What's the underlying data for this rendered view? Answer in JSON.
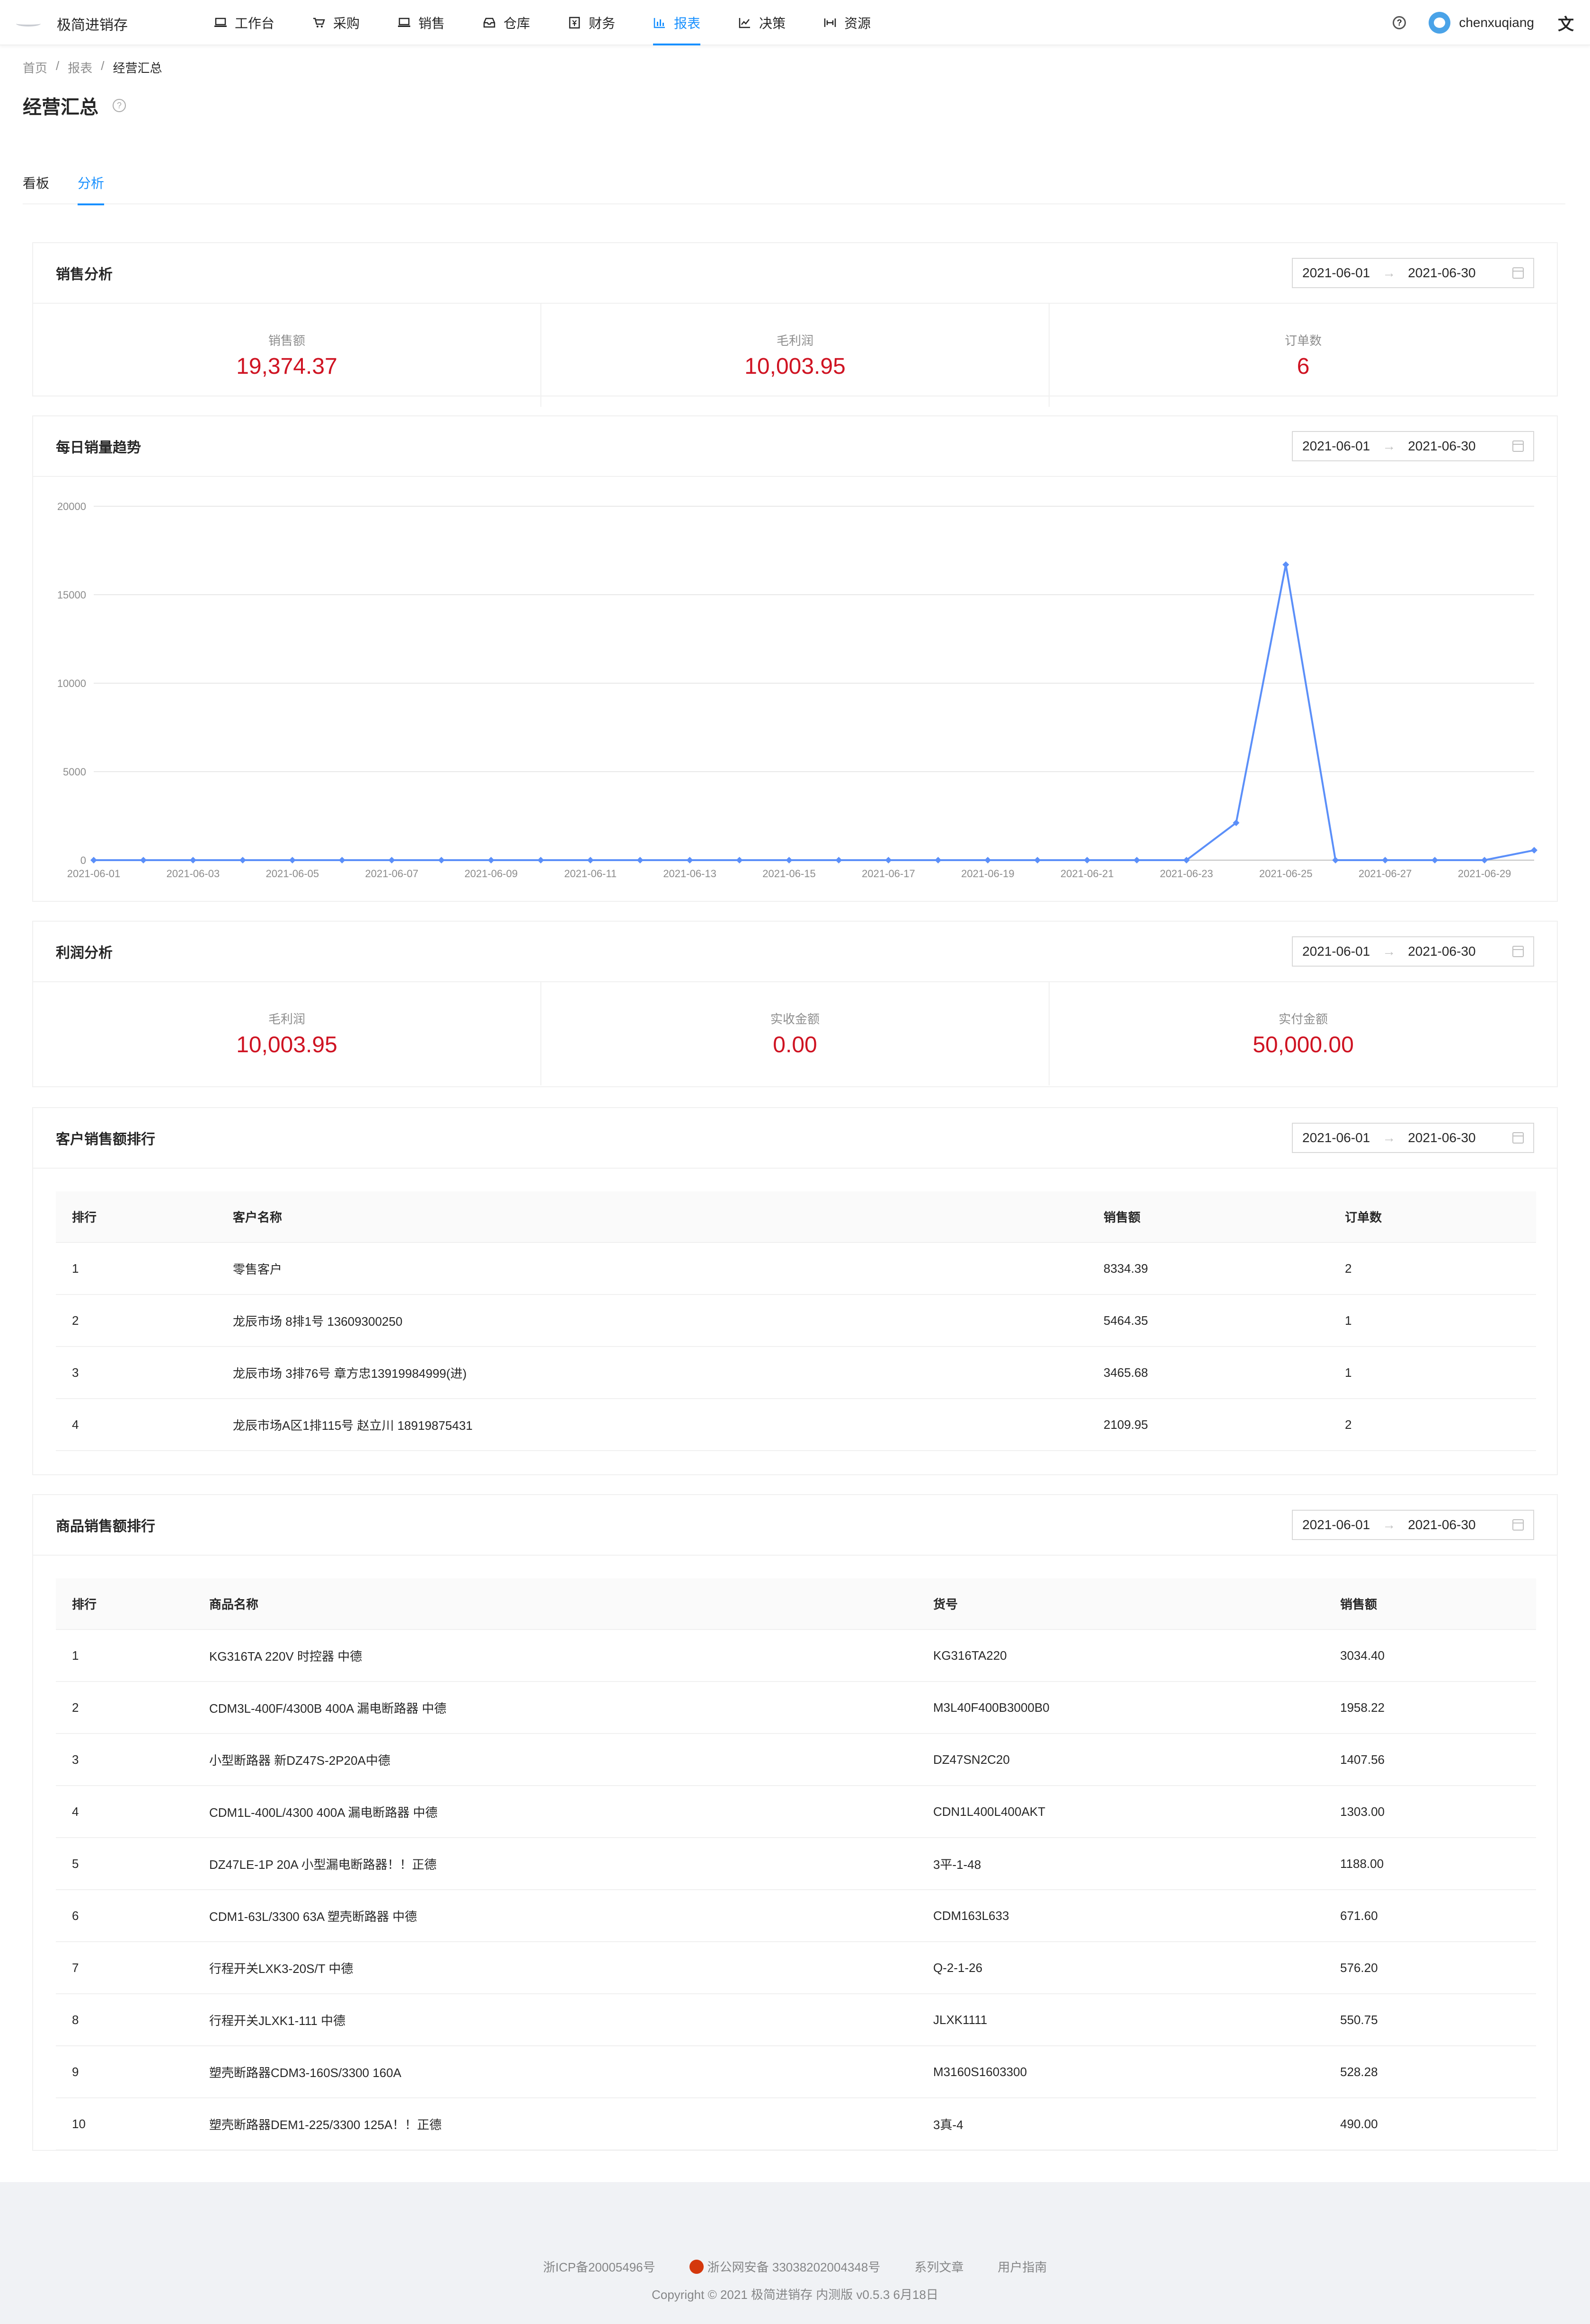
{
  "app": {
    "name": "极简进销存"
  },
  "nav": [
    {
      "label": "工作台",
      "icon": "laptop-icon"
    },
    {
      "label": "采购",
      "icon": "cart-icon"
    },
    {
      "label": "销售",
      "icon": "laptop-icon"
    },
    {
      "label": "仓库",
      "icon": "inbox-icon"
    },
    {
      "label": "财务",
      "icon": "money-icon"
    },
    {
      "label": "报表",
      "icon": "bar-chart-icon"
    },
    {
      "label": "决策",
      "icon": "line-chart-icon"
    },
    {
      "label": "资源",
      "icon": "gateway-icon"
    }
  ],
  "user": {
    "name": "chenxuqiang"
  },
  "breadcrumb": [
    "首页",
    "报表",
    "经营汇总"
  ],
  "page_title": "经营汇总",
  "tabs": [
    "看板",
    "分析"
  ],
  "date_range": {
    "start": "2021-06-01",
    "end": "2021-06-30",
    "arrow": "→"
  },
  "sales_analysis": {
    "title": "销售分析",
    "stats": [
      {
        "label": "销售额",
        "value": "19,374.37"
      },
      {
        "label": "毛利润",
        "value": "10,003.95"
      },
      {
        "label": "订单数",
        "value": "6"
      }
    ]
  },
  "trend": {
    "title": "每日销量趋势"
  },
  "chart_data": {
    "type": "line",
    "x": [
      "2021-06-01",
      "2021-06-02",
      "2021-06-03",
      "2021-06-04",
      "2021-06-05",
      "2021-06-06",
      "2021-06-07",
      "2021-06-08",
      "2021-06-09",
      "2021-06-10",
      "2021-06-11",
      "2021-06-12",
      "2021-06-13",
      "2021-06-14",
      "2021-06-15",
      "2021-06-16",
      "2021-06-17",
      "2021-06-18",
      "2021-06-19",
      "2021-06-20",
      "2021-06-21",
      "2021-06-22",
      "2021-06-23",
      "2021-06-24",
      "2021-06-25",
      "2021-06-26",
      "2021-06-27",
      "2021-06-28",
      "2021-06-29",
      "2021-06-30"
    ],
    "x_tick_labels": [
      "2021-06-01",
      "2021-06-03",
      "2021-06-05",
      "2021-06-07",
      "2021-06-09",
      "2021-06-11",
      "2021-06-13",
      "2021-06-15",
      "2021-06-17",
      "2021-06-19",
      "2021-06-21",
      "2021-06-23",
      "2021-06-25",
      "2021-06-27",
      "2021-06-29"
    ],
    "y": [
      0,
      0,
      0,
      0,
      0,
      0,
      0,
      0,
      0,
      0,
      0,
      0,
      0,
      0,
      0,
      0,
      0,
      0,
      0,
      0,
      0,
      0,
      0,
      2110,
      16700,
      0,
      0,
      0,
      0,
      560
    ],
    "y_ticks": [
      "0",
      "5000",
      "10000",
      "15000",
      "20000"
    ],
    "ylim": [
      0,
      20000
    ],
    "grid": true,
    "color": "#5b8ff9"
  },
  "profit_analysis": {
    "title": "利润分析",
    "stats": [
      {
        "label": "毛利润",
        "value": "10,003.95"
      },
      {
        "label": "实收金额",
        "value": "0.00"
      },
      {
        "label": "实付金额",
        "value": "50,000.00"
      }
    ]
  },
  "customer_rank": {
    "title": "客户销售额排行",
    "columns": [
      "排行",
      "客户名称",
      "销售额",
      "订单数"
    ],
    "rows": [
      [
        "1",
        "零售客户",
        "8334.39",
        "2"
      ],
      [
        "2",
        "龙辰市场 8排1号 13609300250",
        "5464.35",
        "1"
      ],
      [
        "3",
        "龙辰市场 3排76号 章方忠13919984999(进)",
        "3465.68",
        "1"
      ],
      [
        "4",
        "龙辰市场A区1排115号 赵立川 18919875431",
        "2109.95",
        "2"
      ]
    ]
  },
  "product_rank": {
    "title": "商品销售额排行",
    "columns": [
      "排行",
      "商品名称",
      "货号",
      "销售额"
    ],
    "rows": [
      [
        "1",
        "KG316TA 220V 时控器 中德",
        "KG316TA220",
        "3034.40"
      ],
      [
        "2",
        "CDM3L-400F/4300B 400A 漏电断路器 中德",
        "M3L40F400B3000B0",
        "1958.22"
      ],
      [
        "3",
        "小型断路器 新DZ47S-2P20A中德",
        "DZ47SN2C20",
        "1407.56"
      ],
      [
        "4",
        "CDM1L-400L/4300 400A 漏电断路器 中德",
        "CDN1L400L400AKT",
        "1303.00"
      ],
      [
        "5",
        "DZ47LE-1P 20A 小型漏电断路器！！正德",
        "3平-1-48",
        "1188.00"
      ],
      [
        "6",
        "CDM1-63L/3300 63A 塑壳断路器 中德",
        "CDM163L633",
        "671.60"
      ],
      [
        "7",
        "行程开关LXK3-20S/T 中德",
        "Q-2-1-26",
        "576.20"
      ],
      [
        "8",
        "行程开关JLXK1-111 中德",
        "JLXK1111",
        "550.75"
      ],
      [
        "9",
        "塑壳断路器CDM3-160S/3300 160A",
        "M3160S1603300",
        "528.28"
      ],
      [
        "10",
        "塑壳断路器DEM1-225/3300 125A！！正德",
        "3真-4",
        "490.00"
      ]
    ]
  },
  "footer": {
    "icp": "浙ICP备20005496号",
    "police": "浙公网安备 33038202004348号",
    "articles": "系列文章",
    "guide": "用户指南",
    "copyright": "Copyright © 2021 极简进销存 内测版 v0.5.3 6月18日"
  }
}
